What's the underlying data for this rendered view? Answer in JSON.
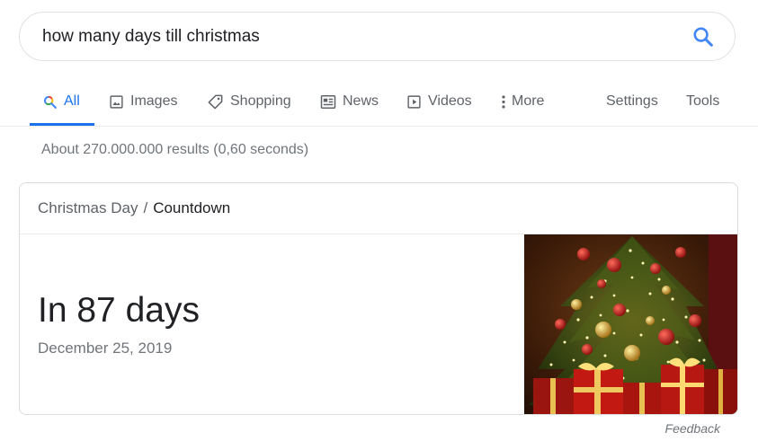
{
  "search": {
    "query": "how many days till christmas"
  },
  "tabs": [
    {
      "label": "All",
      "icon": "search-icon",
      "active": true
    },
    {
      "label": "Images",
      "icon": "image-icon",
      "active": false
    },
    {
      "label": "Shopping",
      "icon": "tag-icon",
      "active": false
    },
    {
      "label": "News",
      "icon": "news-icon",
      "active": false
    },
    {
      "label": "Videos",
      "icon": "video-icon",
      "active": false
    },
    {
      "label": "More",
      "icon": "more-vert-icon",
      "active": false
    }
  ],
  "tools": {
    "settings_label": "Settings",
    "tools_label": "Tools"
  },
  "result_stats": "About 270.000.000 results (0,60 seconds)",
  "card": {
    "breadcrumb_parent": "Christmas Day",
    "breadcrumb_separator": "/",
    "breadcrumb_current": "Countdown",
    "countdown": "In 87 days",
    "date": "December 25, 2019",
    "image": "christmas-tree-image"
  },
  "feedback_label": "Feedback",
  "colors": {
    "accent": "#1a73e8",
    "text_primary": "#202124",
    "text_secondary": "#70757a",
    "border": "#dadce0"
  }
}
